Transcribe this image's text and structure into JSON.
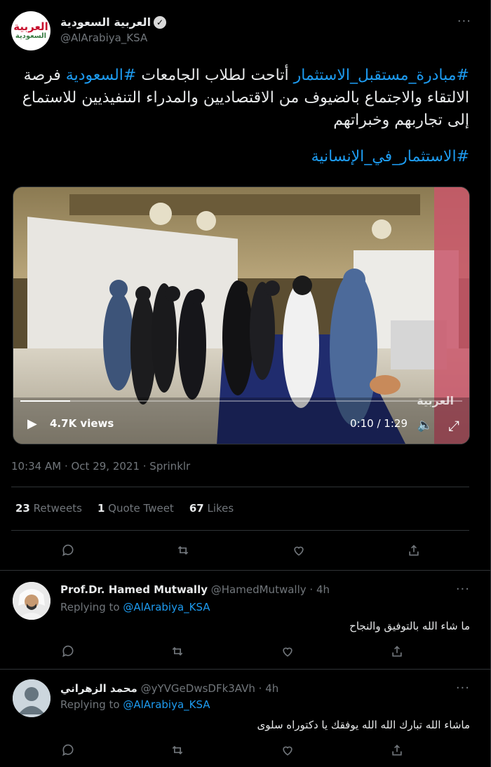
{
  "tweet": {
    "author_name": "العربية السعودية",
    "author_handle": "@AlArabiya_KSA",
    "logo_line1": "العربية",
    "logo_line2": "السعودية",
    "more": "···",
    "text_hashtag1": "#مبادرة_مستقبل_الاستثمار",
    "text_part1": " أتاحت لطلاب الجامعات ",
    "text_hashtag2": "#السعودية",
    "text_part2": " فرصة الالتقاء والاجتماع بالضيوف من الاقتصاديين والمدراء التنفيذيين  للاستماع إلى تجاربهم وخبراتهم",
    "text_hashtag3": "#الاستثمار_في_الإنسانية",
    "timestamp": "10:34 AM · Oct 29, 2021 · Sprinklr",
    "retweets_count": "23",
    "retweets_label": "Retweets",
    "quote_count": "1",
    "quote_label": "Quote Tweet",
    "likes_count": "67",
    "likes_label": "Likes"
  },
  "video": {
    "views": "4.7K views",
    "time": "0:10 / 1:29",
    "progress": 0.112,
    "watermark": "العربية"
  },
  "replies": [
    {
      "name": "Prof.Dr. Hamed Mutwally",
      "handle": "@HamedMutwally",
      "age": "· 4h",
      "replying_prefix": "Replying to",
      "replying_to": "@AlArabiya_KSA",
      "text": "ما شاء الله بالتوفيق والنجاح",
      "more": "···"
    },
    {
      "name": "محمد الزهراني",
      "handle": "@yYVGeDwsDFk3AVh",
      "age": "· 4h",
      "replying_prefix": "Replying to",
      "replying_to": "@AlArabiya_KSA",
      "text": "ماشاء الله تبارك الله الله يوفقك يا دكتوراه سلوى",
      "more": "···"
    }
  ],
  "icons": [
    "reply-icon",
    "retweet-icon",
    "like-icon",
    "share-icon",
    "play-icon",
    "volume-icon",
    "fullscreen-icon",
    "verified-icon"
  ]
}
